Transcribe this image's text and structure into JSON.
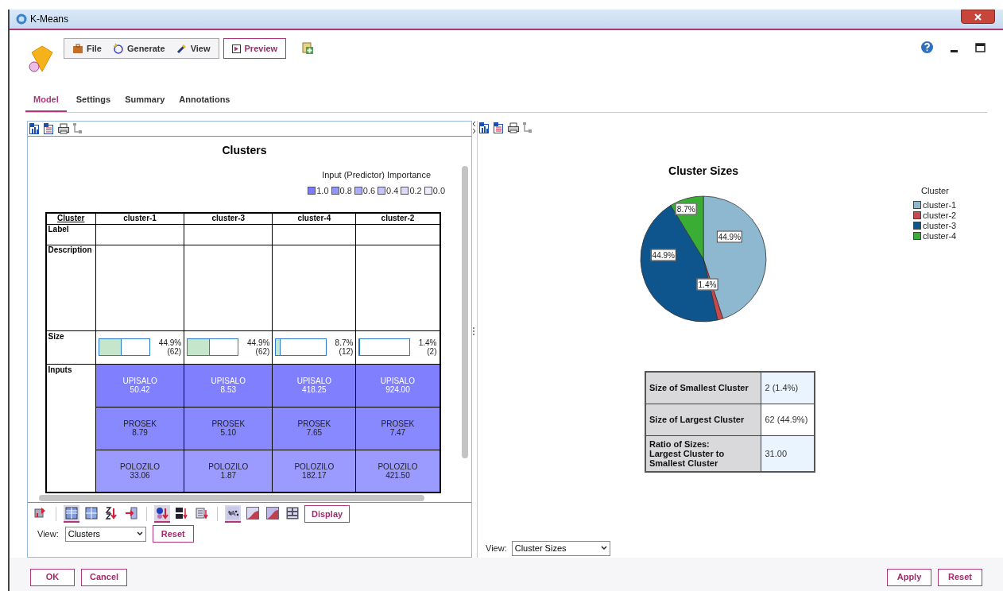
{
  "window": {
    "title": "K-Means"
  },
  "menu": [
    {
      "label": "File",
      "kind": "briefcase"
    },
    {
      "label": "Generate",
      "kind": "sparkle"
    },
    {
      "label": "View",
      "kind": "flashlight"
    }
  ],
  "preview_button": "Preview",
  "tabs": [
    {
      "label": "Model",
      "selected": true
    },
    {
      "label": "Settings",
      "selected": false
    },
    {
      "label": "Summary",
      "selected": false
    },
    {
      "label": "Annotations",
      "selected": false
    }
  ],
  "left_panel": {
    "title": "Clusters",
    "importance": {
      "title": "Input (Predictor) Importance",
      "items": [
        {
          "label": "1.0",
          "color": "#7b7bff"
        },
        {
          "label": "0.8",
          "color": "#9595ff"
        },
        {
          "label": "0.6",
          "color": "#adadff"
        },
        {
          "label": "0.4",
          "color": "#c4c4ff"
        },
        {
          "label": "0.2",
          "color": "#dadaff"
        },
        {
          "label": "0.0",
          "color": "#ececff"
        }
      ]
    },
    "table": {
      "corner": "Cluster",
      "columns": [
        "cluster-1",
        "cluster-3",
        "cluster-4",
        "cluster-2"
      ],
      "label_row": "Label",
      "description_row": "Description",
      "size_row": "Size",
      "inputs_row": "Inputs",
      "sizes": [
        {
          "level": 0.449,
          "percent": "44.9%",
          "count": "(62)"
        },
        {
          "level": 0.449,
          "percent": "44.9%",
          "count": "(62)"
        },
        {
          "level": 0.087,
          "percent": "8.7%",
          "count": "(12)"
        },
        {
          "level": 0.014,
          "percent": "1.4%",
          "count": "(2)"
        }
      ],
      "inputs": [
        {
          "color": "#8080ff",
          "light_text": true,
          "cells": [
            {
              "name": "UPISALO",
              "value": "50.42"
            },
            {
              "name": "UPISALO",
              "value": "8.53"
            },
            {
              "name": "UPISALO",
              "value": "418.25"
            },
            {
              "name": "UPISALO",
              "value": "924.00"
            }
          ]
        },
        {
          "color": "#8888ff",
          "light_text": false,
          "cells": [
            {
              "name": "PROSEK",
              "value": "8.79"
            },
            {
              "name": "PROSEK",
              "value": "5.10"
            },
            {
              "name": "PROSEK",
              "value": "7.65"
            },
            {
              "name": "PROSEK",
              "value": "7.47"
            }
          ]
        },
        {
          "color": "#9b9bff",
          "light_text": false,
          "cells": [
            {
              "name": "POLOZILO",
              "value": "33.06"
            },
            {
              "name": "POLOZILO",
              "value": "1.87"
            },
            {
              "name": "POLOZILO",
              "value": "182.17"
            },
            {
              "name": "POLOZILO",
              "value": "421.50"
            }
          ]
        }
      ]
    },
    "tools": [
      {
        "kind": "transpose",
        "selected": false,
        "sep_after": true
      },
      {
        "kind": "grid",
        "selected": true
      },
      {
        "kind": "grid2",
        "selected": false
      },
      {
        "kind": "sort_az",
        "selected": false
      },
      {
        "kind": "arrow_in",
        "selected": false,
        "sep_after": true
      },
      {
        "kind": "sort_dot",
        "selected": true
      },
      {
        "kind": "sort_c1c2",
        "selected": false
      },
      {
        "kind": "sort_list",
        "selected": false,
        "sep_after": true
      },
      {
        "kind": "percent",
        "selected": true
      },
      {
        "kind": "curve",
        "selected": false
      },
      {
        "kind": "curve2",
        "selected": false
      },
      {
        "kind": "list",
        "selected": false
      }
    ],
    "display_button": "Display",
    "view": {
      "label": "View:",
      "value": "Clusters"
    },
    "reset_button": "Reset"
  },
  "right_panel": {
    "chart": {
      "chart_data": {
        "type": "pie",
        "title": "Cluster Sizes",
        "categories": [
          "cluster-1",
          "cluster-2",
          "cluster-3",
          "cluster-4"
        ],
        "values": [
          44.9,
          1.4,
          44.9,
          8.7
        ],
        "value_labels": [
          "44.9%",
          "1.4%",
          "44.9%",
          "8.7%"
        ]
      },
      "legend": {
        "title": "Cluster",
        "items": [
          {
            "color": "#8db8d0"
          },
          {
            "color": "#c8484e"
          },
          {
            "color": "#0d558c"
          },
          {
            "color": "#3aae34"
          }
        ]
      }
    },
    "summary": [
      {
        "label": "Size of Smallest Cluster",
        "value": "2 (1.4%)"
      },
      {
        "label": "Size of Largest Cluster",
        "value": "62 (44.9%)"
      },
      {
        "label": "Ratio of Sizes:\nLargest Cluster to\nSmallest Cluster",
        "value": "31.00"
      }
    ],
    "view": {
      "label": "View:",
      "value": "Cluster Sizes"
    }
  },
  "footer": {
    "left": [
      "OK",
      "Cancel"
    ],
    "right": [
      "Apply",
      "Reset"
    ]
  }
}
